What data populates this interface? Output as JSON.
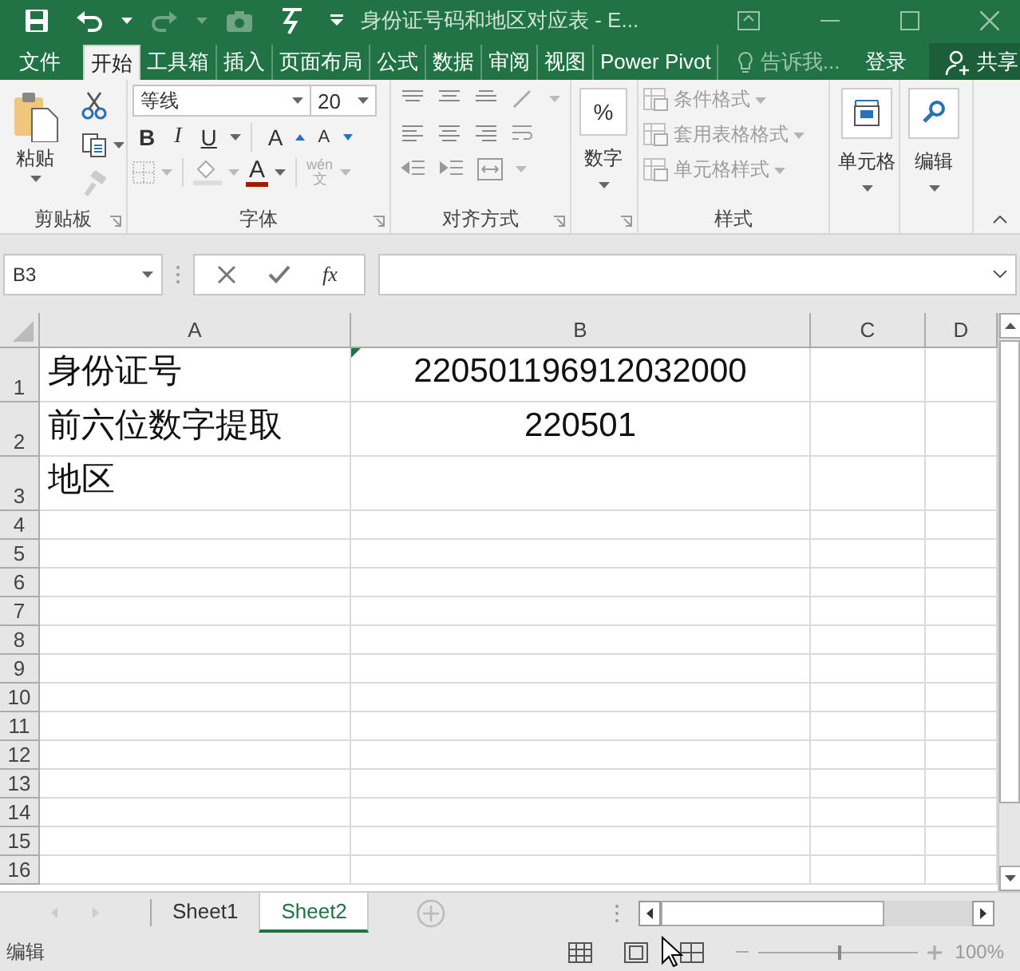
{
  "title_bar": {
    "title": "身份证号码和地区对应表 - E...",
    "redo_disabled": true
  },
  "ribbon_tabs": [
    {
      "label": "文件",
      "selected": false
    },
    {
      "label": "开始",
      "selected": true
    },
    {
      "label": "工具箱",
      "selected": false
    },
    {
      "label": "插入",
      "selected": false
    },
    {
      "label": "页面布局",
      "selected": false
    },
    {
      "label": "公式",
      "selected": false
    },
    {
      "label": "数据",
      "selected": false
    },
    {
      "label": "审阅",
      "selected": false
    },
    {
      "label": "视图",
      "selected": false
    },
    {
      "label": "Power Pivot",
      "selected": false
    }
  ],
  "tell_me": {
    "placeholder": "告诉我..."
  },
  "sign_in": "登录",
  "share": "共享",
  "ribbon": {
    "clipboard": {
      "paste": "粘贴",
      "label": "剪贴板"
    },
    "font": {
      "font_name": "等线",
      "font_size": "20",
      "bold": "B",
      "italic": "I",
      "underline": "U",
      "grow": "A",
      "shrink": "A",
      "font_color": "A",
      "phonetic_top": "wén",
      "phonetic_bottom": "文",
      "label": "字体"
    },
    "alignment": {
      "label": "对齐方式"
    },
    "number": {
      "symbol": "%",
      "button": "数字"
    },
    "styles": {
      "items": [
        {
          "label": "条件格式",
          "disabled": true
        },
        {
          "label": "套用表格格式",
          "disabled": true
        },
        {
          "label": "单元格样式",
          "disabled": true
        }
      ],
      "label": "样式"
    },
    "cells": {
      "button": "单元格"
    },
    "editing": {
      "button": "编辑"
    }
  },
  "formula_bar": {
    "name_box": "B3",
    "function_label": "fx"
  },
  "columns": [
    {
      "label": "A",
      "centered": false
    },
    {
      "label": "B",
      "centered": true
    },
    {
      "label": "C"
    },
    {
      "label": "D"
    }
  ],
  "rows": [
    {
      "number": "1",
      "cells": [
        {
          "text": "身份证号",
          "error_indicator": false
        },
        {
          "text": "220501196912032000",
          "error_indicator": true
        }
      ]
    },
    {
      "number": "2",
      "cells": [
        {
          "text": "前六位数字提取",
          "error_indicator": false
        },
        {
          "text": "220501",
          "error_indicator": false
        }
      ]
    },
    {
      "number": "3",
      "cells": [
        {
          "text": "地区",
          "error_indicator": false
        }
      ]
    },
    {
      "number": "4"
    },
    {
      "number": "5"
    },
    {
      "number": "6"
    },
    {
      "number": "7"
    },
    {
      "number": "8"
    },
    {
      "number": "9"
    },
    {
      "number": "10"
    },
    {
      "number": "11"
    },
    {
      "number": "12"
    },
    {
      "number": "13"
    },
    {
      "number": "14"
    },
    {
      "number": "15"
    },
    {
      "number": "16"
    }
  ],
  "sheet_tabs": [
    {
      "label": "Sheet1",
      "selected": false
    },
    {
      "label": "Sheet2",
      "selected": true
    }
  ],
  "status_bar": {
    "mode": "编辑",
    "zoom": "100%",
    "level": 0.5
  }
}
